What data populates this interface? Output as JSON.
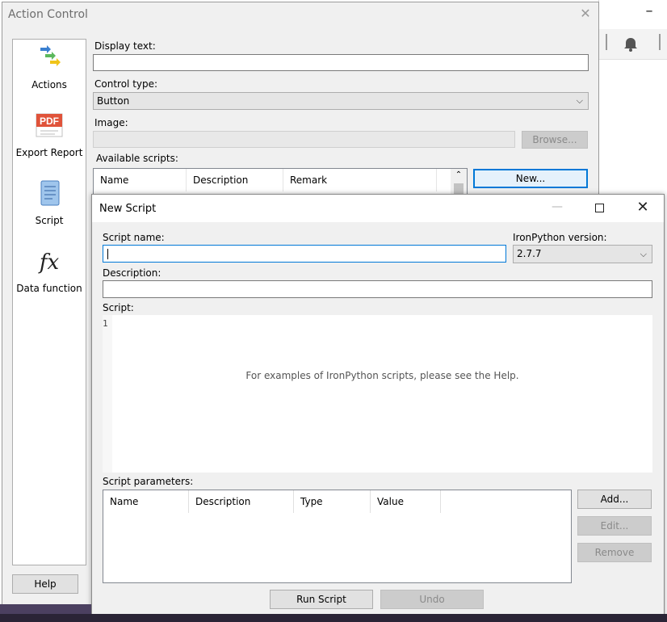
{
  "action_control": {
    "title": "Action Control",
    "sidebar": {
      "items": [
        {
          "label": "Actions",
          "icon": "actions-arrows-icon"
        },
        {
          "label": "Export Report",
          "icon": "pdf-icon"
        },
        {
          "label": "Script",
          "icon": "script-document-icon"
        },
        {
          "label": "Data function",
          "icon": "function-fx-icon"
        }
      ],
      "help_label": "Help"
    },
    "display_text": {
      "label": "Display text:",
      "value": ""
    },
    "control_type": {
      "label": "Control type:",
      "value": "Button"
    },
    "image": {
      "label": "Image:",
      "value": "",
      "browse_label": "Browse..."
    },
    "available_scripts": {
      "label": "Available scripts:",
      "columns": [
        "Name",
        "Description",
        "Remark"
      ],
      "new_label": "New..."
    }
  },
  "new_script": {
    "title": "New Script",
    "script_name": {
      "label": "Script name:",
      "value": ""
    },
    "ironpython": {
      "label": "IronPython version:",
      "value": "2.7.7"
    },
    "description": {
      "label": "Description:",
      "value": ""
    },
    "script": {
      "label": "Script:",
      "line_number": "1",
      "hint": "For examples of IronPython scripts, please see the Help."
    },
    "parameters": {
      "label": "Script parameters:",
      "columns": [
        "Name",
        "Description",
        "Type",
        "Value"
      ],
      "add_label": "Add...",
      "edit_label": "Edit...",
      "remove_label": "Remove"
    },
    "run_label": "Run Script",
    "undo_label": "Undo"
  },
  "colors": {
    "dialog_bg": "#f0f0f0",
    "accent": "#0078d7",
    "disabled_bg": "#cccccc",
    "disabled_text": "#8a8a8a"
  }
}
